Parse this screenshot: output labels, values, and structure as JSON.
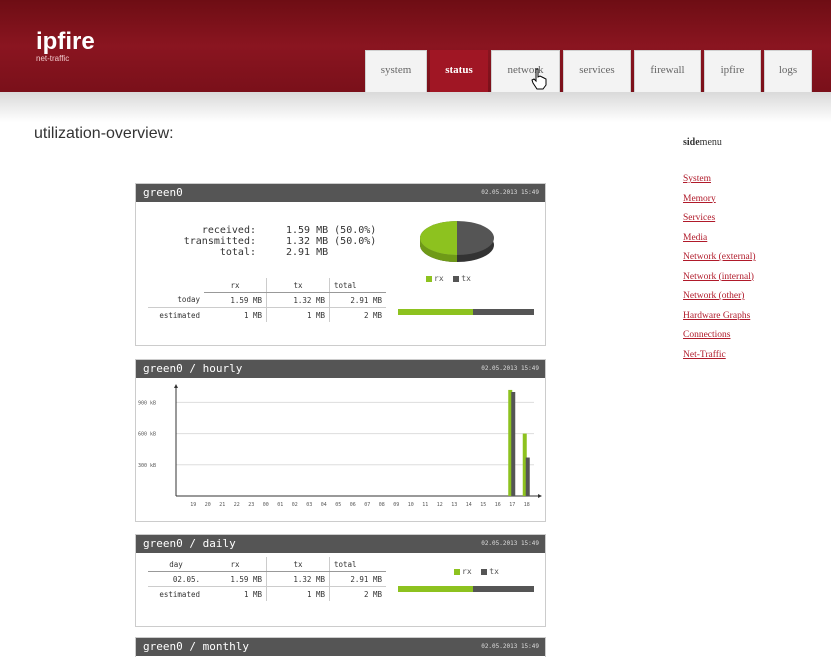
{
  "app": {
    "logo": "ipfire",
    "subtitle": "net-traffic"
  },
  "tabs": [
    {
      "label": "system",
      "active": false
    },
    {
      "label": "status",
      "active": true
    },
    {
      "label": "network",
      "active": false
    },
    {
      "label": "services",
      "active": false
    },
    {
      "label": "firewall",
      "active": false
    },
    {
      "label": "ipfire",
      "active": false
    },
    {
      "label": "logs",
      "active": false
    }
  ],
  "page_title": "utilization-overview:",
  "sidemenu": {
    "title_bold": "side",
    "title_rest": "menu",
    "items": [
      "System",
      "Memory",
      "Services",
      "Media",
      "Network (external)",
      "Network (internal)",
      "Network (other)",
      "Hardware Graphs",
      "Connections",
      "Net-Traffic"
    ]
  },
  "colors": {
    "rx": "#8dc21f",
    "tx": "#555555",
    "accent": "#a01624"
  },
  "summary": {
    "title": "green0",
    "date": "02.05.2013 15:49",
    "received_label": "received:",
    "received_value": "1.59 MB (50.0%)",
    "transmitted_label": "transmitted:",
    "transmitted_value": "1.32 MB (50.0%)",
    "total_label": "total:",
    "total_value": "2.91 MB",
    "legend_rx": "rx",
    "legend_tx": "tx",
    "table": {
      "headers": [
        "rx",
        "tx",
        "total"
      ],
      "rows": [
        {
          "label": "today",
          "rx": "1.59 MB",
          "tx": "1.32 MB",
          "total": "2.91 MB",
          "rx_fraction": 0.55
        },
        {
          "label": "estimated",
          "rx": "1 MB",
          "tx": "1 MB",
          "total": "2 MB"
        }
      ]
    }
  },
  "hourly": {
    "title": "green0 / hourly",
    "date": "02.05.2013 15:49",
    "chart_data": {
      "type": "bar",
      "categories": [
        "19",
        "20",
        "21",
        "22",
        "23",
        "00",
        "01",
        "02",
        "03",
        "04",
        "05",
        "06",
        "07",
        "08",
        "09",
        "10",
        "11",
        "12",
        "13",
        "14",
        "15",
        "16",
        "17",
        "18"
      ],
      "y_ticks": [
        "900 kB",
        "600 kB",
        "300 kB"
      ],
      "ylim": [
        0,
        1000
      ],
      "series": [
        {
          "name": "rx",
          "values": [
            0,
            0,
            0,
            0,
            0,
            0,
            0,
            0,
            0,
            0,
            0,
            0,
            0,
            0,
            0,
            0,
            0,
            0,
            0,
            0,
            0,
            0,
            1020,
            600
          ]
        },
        {
          "name": "tx",
          "values": [
            0,
            0,
            0,
            0,
            0,
            0,
            0,
            0,
            0,
            0,
            0,
            0,
            0,
            0,
            0,
            0,
            0,
            0,
            0,
            0,
            0,
            0,
            1000,
            370
          ]
        }
      ]
    }
  },
  "daily": {
    "title": "green0 / daily",
    "date": "02.05.2013 15:49",
    "headers": [
      "day",
      "rx",
      "tx",
      "total"
    ],
    "legend_rx": "rx",
    "legend_tx": "tx",
    "rows": [
      {
        "day": "02.05.",
        "rx": "1.59 MB",
        "tx": "1.32 MB",
        "total": "2.91 MB",
        "rx_fraction": 0.55
      },
      {
        "day": "estimated",
        "rx": "1 MB",
        "tx": "1 MB",
        "total": "2 MB"
      }
    ]
  },
  "monthly": {
    "title": "green0 / monthly",
    "date": "02.05.2013 15:49"
  }
}
